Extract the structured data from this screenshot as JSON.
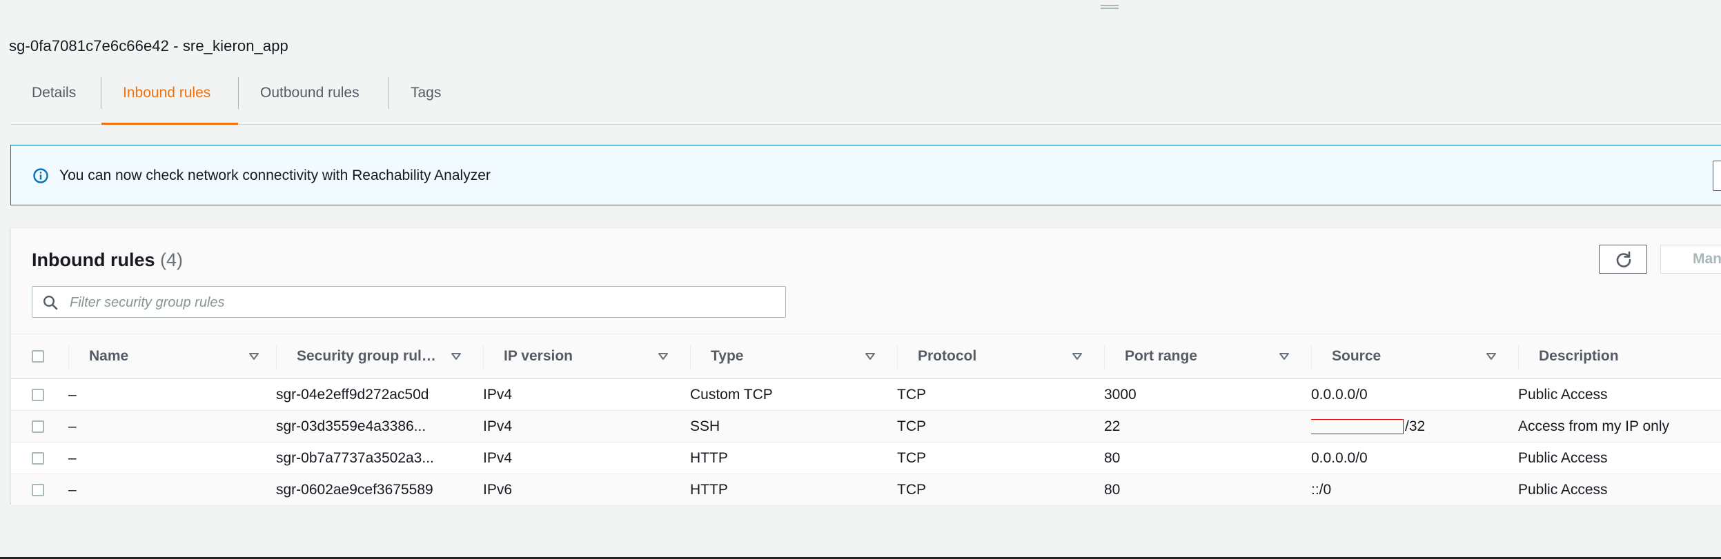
{
  "security_group": {
    "title": "sg-0fa7081c7e6c66e42 - sre_kieron_app"
  },
  "tabs": [
    {
      "label": "Details",
      "active": false
    },
    {
      "label": "Inbound rules",
      "active": true
    },
    {
      "label": "Outbound rules",
      "active": false
    },
    {
      "label": "Tags",
      "active": false
    }
  ],
  "alert": {
    "icon": "info-icon",
    "message": "You can now check network connectivity with Reachability Analyzer"
  },
  "panel": {
    "title": "Inbound rules",
    "count": "(4)",
    "refresh_icon": "refresh-icon",
    "manage_label": "Manage",
    "filter_placeholder": "Filter security group rules"
  },
  "columns": [
    {
      "label": "Name"
    },
    {
      "label": "Security group rule..."
    },
    {
      "label": "IP version"
    },
    {
      "label": "Type"
    },
    {
      "label": "Protocol"
    },
    {
      "label": "Port range"
    },
    {
      "label": "Source"
    },
    {
      "label": "Description"
    }
  ],
  "rows": [
    {
      "name": "–",
      "rule_id": "sgr-04e2eff9d272ac50d",
      "ip_version": "IPv4",
      "type": "Custom TCP",
      "protocol": "TCP",
      "port_range": "3000",
      "source": "0.0.0.0/0",
      "description": "Public Access"
    },
    {
      "name": "–",
      "rule_id": "sgr-03d3559e4a3386...",
      "ip_version": "IPv4",
      "type": "SSH",
      "protocol": "TCP",
      "port_range": "22",
      "source": "/32",
      "source_redacted": true,
      "description": "Access from my IP only"
    },
    {
      "name": "–",
      "rule_id": "sgr-0b7a7737a3502a3...",
      "ip_version": "IPv4",
      "type": "HTTP",
      "protocol": "TCP",
      "port_range": "80",
      "source": "0.0.0.0/0",
      "description": "Public Access"
    },
    {
      "name": "–",
      "rule_id": "sgr-0602ae9cef3675589",
      "ip_version": "IPv6",
      "type": "HTTP",
      "protocol": "TCP",
      "port_range": "80",
      "source": "::/0",
      "description": "Public Access"
    }
  ],
  "colors": {
    "accent": "#ec7211",
    "info": "#0073bb",
    "redaction": "#ee0000"
  }
}
